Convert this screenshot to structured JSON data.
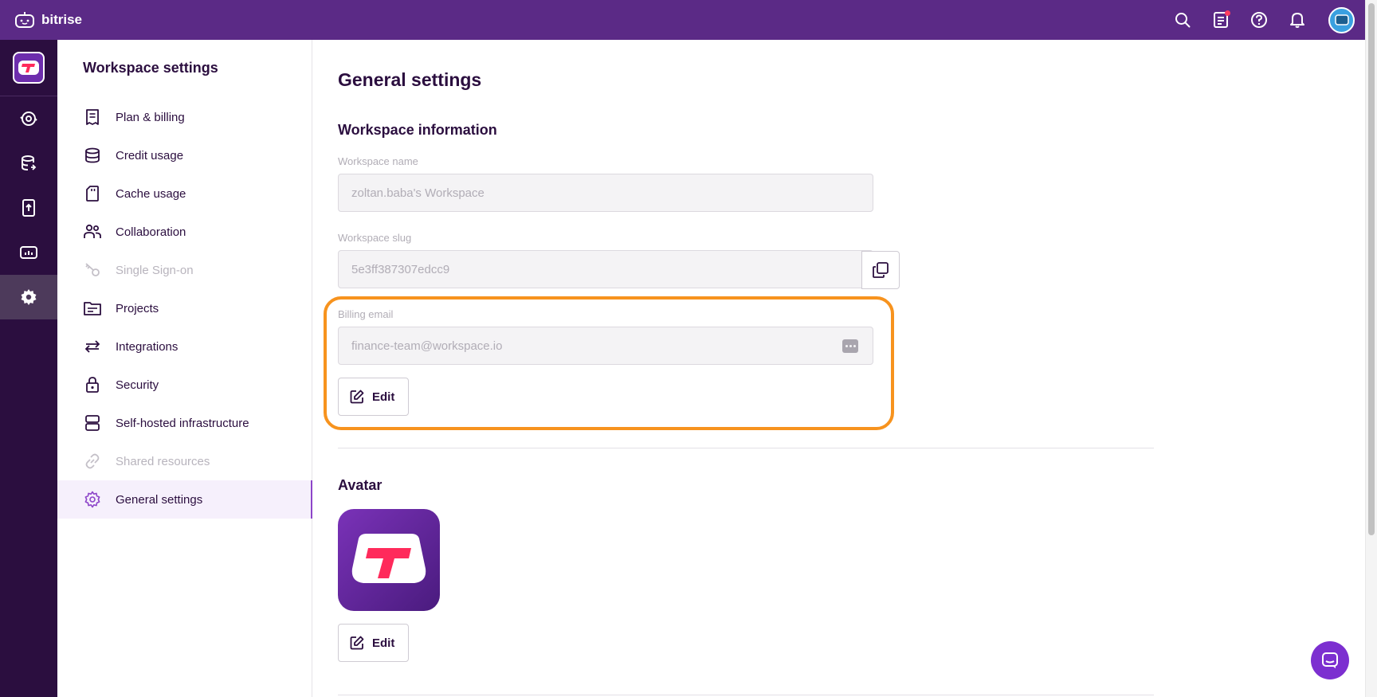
{
  "app": {
    "brand": "bitrise"
  },
  "colors": {
    "topbar": "#5b2a86",
    "rail": "#2b0e3f",
    "accent": "#8d45c9",
    "highlight": "#f7931e",
    "brand_red": "#ff2a5b"
  },
  "topbar": {
    "icons": [
      "search-icon",
      "changelog-icon",
      "help-icon",
      "bell-icon",
      "user-avatar"
    ]
  },
  "rail": {
    "items": [
      "workspace-logo",
      "builds-icon",
      "releases-icon",
      "deploy-icon",
      "insights-icon",
      "settings-icon"
    ],
    "active": "settings-icon"
  },
  "sidebar": {
    "title": "Workspace settings",
    "items": [
      {
        "label": "Plan & billing",
        "icon": "receipt-icon"
      },
      {
        "label": "Credit usage",
        "icon": "coins-icon"
      },
      {
        "label": "Cache usage",
        "icon": "sd-card-icon"
      },
      {
        "label": "Collaboration",
        "icon": "people-icon"
      },
      {
        "label": "Single Sign-on",
        "icon": "key-icon",
        "disabled": true
      },
      {
        "label": "Projects",
        "icon": "folder-icon"
      },
      {
        "label": "Integrations",
        "icon": "arrows-icon"
      },
      {
        "label": "Security",
        "icon": "lock-icon"
      },
      {
        "label": "Self-hosted infrastructure",
        "icon": "server-icon"
      },
      {
        "label": "Shared resources",
        "icon": "link-icon",
        "disabled": true
      },
      {
        "label": "General settings",
        "icon": "gear-icon",
        "active": true
      }
    ]
  },
  "main": {
    "title": "General settings",
    "workspace_info": {
      "title": "Workspace information",
      "name_label": "Workspace name",
      "name_value": "zoltan.baba's Workspace",
      "slug_label": "Workspace slug",
      "slug_value": "5e3ff387307edcc9",
      "email_label": "Billing email",
      "email_value": "finance-team@workspace.io",
      "edit_label": "Edit"
    },
    "avatar": {
      "title": "Avatar",
      "edit_label": "Edit"
    }
  }
}
